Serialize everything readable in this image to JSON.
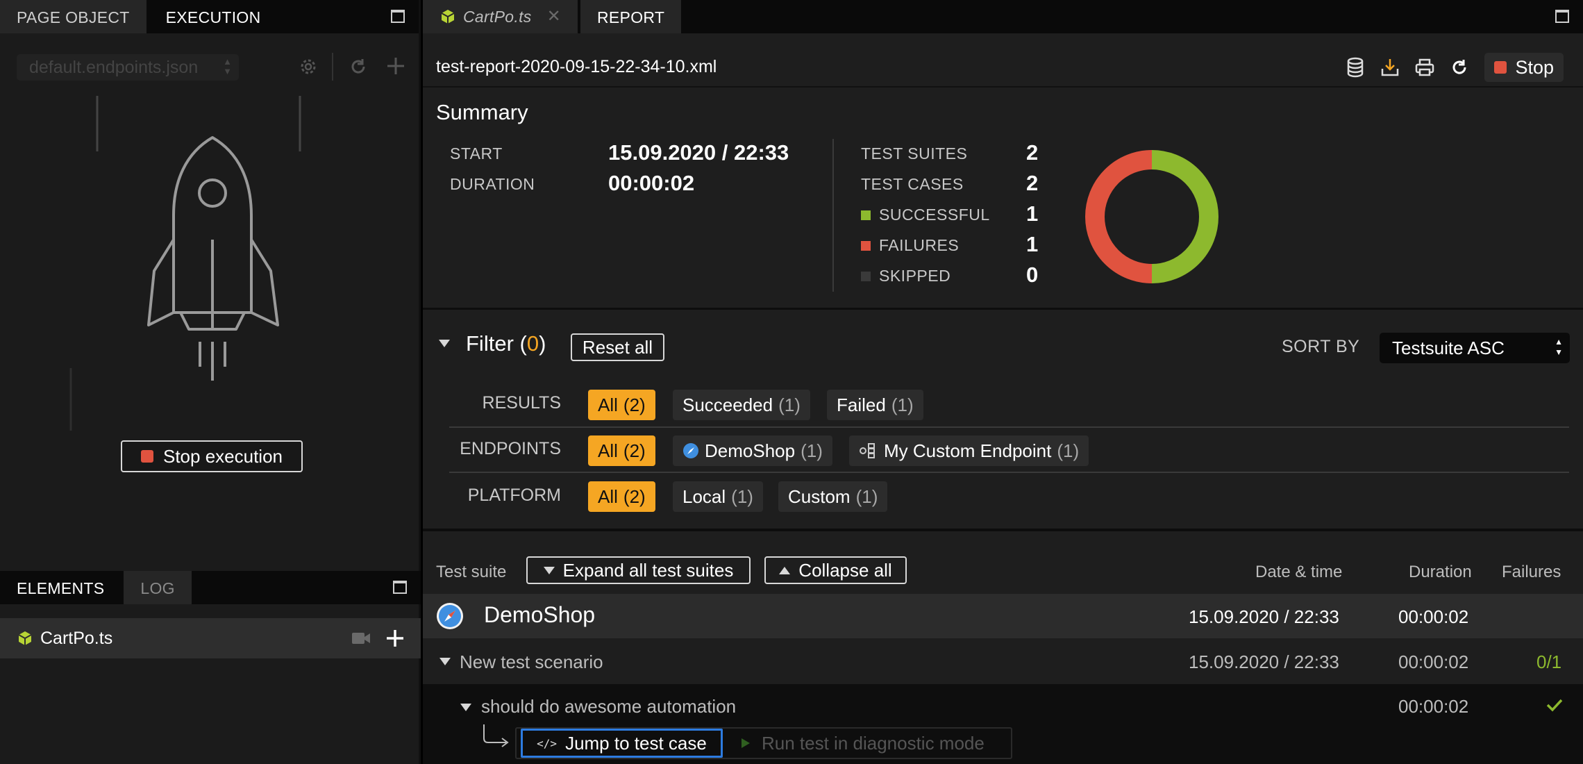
{
  "left": {
    "tabs": [
      {
        "label": "PAGE OBJECT",
        "active": false
      },
      {
        "label": "EXECUTION",
        "active": true
      }
    ],
    "endpoint_select": "default.endpoints.json",
    "stop_execution": "Stop execution",
    "bottom_tabs": [
      {
        "label": "ELEMENTS",
        "active": true
      },
      {
        "label": "LOG",
        "active": false
      }
    ],
    "files": [
      {
        "name": "CartPo.ts"
      }
    ]
  },
  "right": {
    "tabs": [
      {
        "label": "CartPo.ts",
        "type": "file"
      },
      {
        "label": "REPORT",
        "active": true
      }
    ],
    "report_file": "test-report-2020-09-15-22-34-10.xml",
    "stop_label": "Stop",
    "summary": {
      "title": "Summary",
      "start_label": "START",
      "start_value": "15.09.2020 / 22:33",
      "duration_label": "DURATION",
      "duration_value": "00:00:02",
      "stats": [
        {
          "label": "TEST SUITES",
          "value": "2"
        },
        {
          "label": "TEST CASES",
          "value": "2"
        },
        {
          "label": "SUCCESSFUL",
          "value": "1",
          "color": "#8db92e"
        },
        {
          "label": "FAILURES",
          "value": "1",
          "color": "#e0533f"
        },
        {
          "label": "SKIPPED",
          "value": "0",
          "color": "#3a3a3a"
        }
      ]
    },
    "filter": {
      "title": "Filter",
      "paren_open": "(",
      "count": "0",
      "paren_close": ")",
      "reset_all": "Reset all",
      "sort_label": "SORT BY",
      "sort_value": "Testsuite ASC",
      "rows": [
        {
          "label": "RESULTS",
          "chips": [
            {
              "label": "All",
              "count": "(2)",
              "selected": true
            },
            {
              "label": "Succeeded",
              "count": "(1)"
            },
            {
              "label": "Failed",
              "count": "(1)"
            }
          ]
        },
        {
          "label": "ENDPOINTS",
          "chips": [
            {
              "label": "All",
              "count": "(2)",
              "selected": true
            },
            {
              "label": "DemoShop",
              "count": "(1)",
              "icon": "safari-icon"
            },
            {
              "label": "My Custom Endpoint",
              "count": "(1)",
              "icon": "custom-endpoint-icon"
            }
          ]
        },
        {
          "label": "PLATFORM",
          "chips": [
            {
              "label": "All",
              "count": "(2)",
              "selected": true
            },
            {
              "label": "Local",
              "count": "(1)"
            },
            {
              "label": "Custom",
              "count": "(1)"
            }
          ]
        }
      ]
    },
    "tree": {
      "suite_label": "Test suite",
      "expand_all": "Expand all test suites",
      "collapse_all": "Collapse all",
      "col_datetime": "Date & time",
      "col_duration": "Duration",
      "col_failures": "Failures",
      "suite": {
        "name": "DemoShop",
        "datetime": "15.09.2020 / 22:33",
        "duration": "00:00:02"
      },
      "scenario": {
        "name": "New test scenario",
        "datetime": "15.09.2020 / 22:33",
        "duration": "00:00:02",
        "failures": "0/1"
      },
      "case": {
        "name": "should do awesome automation",
        "duration": "00:00:02"
      },
      "jump_label": "Jump to test case",
      "diagnostic_label": "Run test in diagnostic mode"
    }
  },
  "colors": {
    "accent": "#f5a623",
    "success": "#8db92e",
    "failure": "#e0533f",
    "focus": "#2d7be0"
  }
}
